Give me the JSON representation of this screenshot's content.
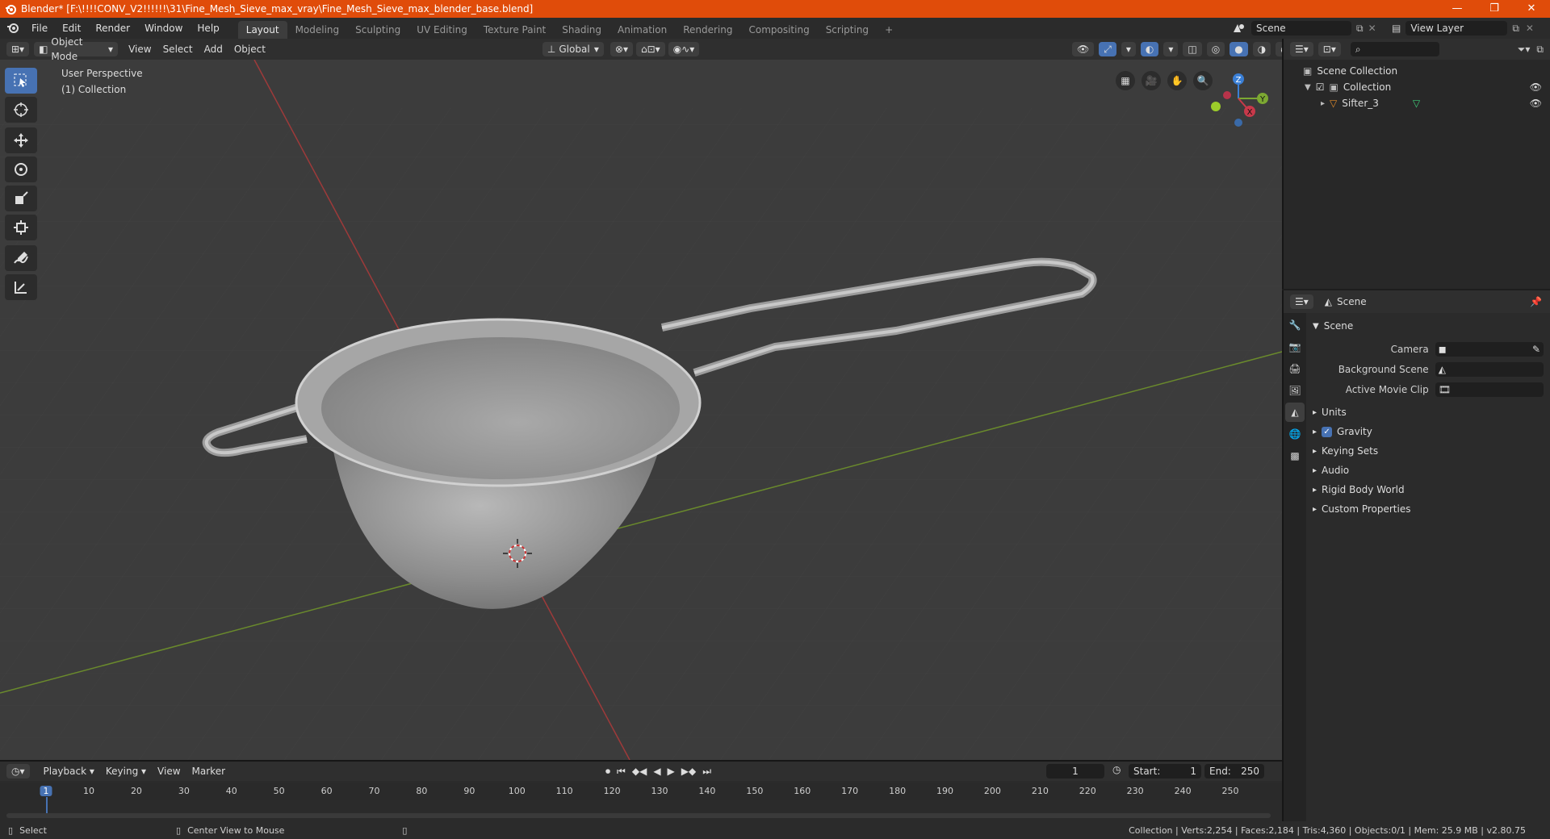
{
  "window": {
    "title": "Blender* [F:\\!!!!CONV_V2!!!!!!\\31\\Fine_Mesh_Sieve_max_vray\\Fine_Mesh_Sieve_max_blender_base.blend]",
    "minimize": "—",
    "maximize": "❐",
    "close": "✕"
  },
  "topbar": {
    "menus": [
      "File",
      "Edit",
      "Render",
      "Window",
      "Help"
    ],
    "workspaces": [
      "Layout",
      "Modeling",
      "Sculpting",
      "UV Editing",
      "Texture Paint",
      "Shading",
      "Animation",
      "Rendering",
      "Compositing",
      "Scripting"
    ],
    "active_workspace": "Layout",
    "add_workspace": "+",
    "scene_label": "Scene",
    "view_layer_label": "View Layer"
  },
  "viewport_header": {
    "mode": "Object Mode",
    "menus": [
      "View",
      "Select",
      "Add",
      "Object"
    ],
    "transform_orientation": "Global"
  },
  "viewport": {
    "perspective_label": "User Perspective",
    "collection_label": "(1) Collection",
    "gizmo_axes": [
      "Z",
      "Y",
      "X"
    ]
  },
  "outliner": {
    "search_placeholder": "",
    "items": [
      {
        "label": "Scene Collection",
        "indent": 0
      },
      {
        "label": "Collection",
        "indent": 1
      },
      {
        "label": "Sifter_3",
        "indent": 2
      }
    ]
  },
  "properties": {
    "context": "Scene",
    "section": "Scene",
    "fields": [
      {
        "label": "Camera",
        "value": ""
      },
      {
        "label": "Background Scene",
        "value": ""
      },
      {
        "label": "Active Movie Clip",
        "value": ""
      }
    ],
    "subsections": [
      "Units",
      "Gravity",
      "Keying Sets",
      "Audio",
      "Rigid Body World",
      "Custom Properties"
    ],
    "gravity_checked": true
  },
  "timeline": {
    "menus": [
      "Playback",
      "Keying",
      "View",
      "Marker"
    ],
    "current_frame": "1",
    "start_label": "Start:",
    "start_value": "1",
    "end_label": "End:",
    "end_value": "250",
    "ticks": [
      "1",
      "10",
      "20",
      "30",
      "40",
      "50",
      "60",
      "70",
      "80",
      "90",
      "100",
      "110",
      "120",
      "130",
      "140",
      "150",
      "160",
      "170",
      "180",
      "190",
      "200",
      "210",
      "220",
      "230",
      "240",
      "250"
    ]
  },
  "status": {
    "left_action": "Select",
    "middle_action": "Center View to Mouse",
    "stats": "Collection | Verts:2,254 | Faces:2,184 | Tris:4,360 | Objects:0/1 | Mem: 25.9 MB | v2.80.75"
  },
  "colors": {
    "titlebar": "#e04c0a",
    "accent": "#4772b3",
    "x_axis": "#c8394a",
    "y_axis": "#7ca832",
    "z_axis": "#3a7fd6"
  }
}
